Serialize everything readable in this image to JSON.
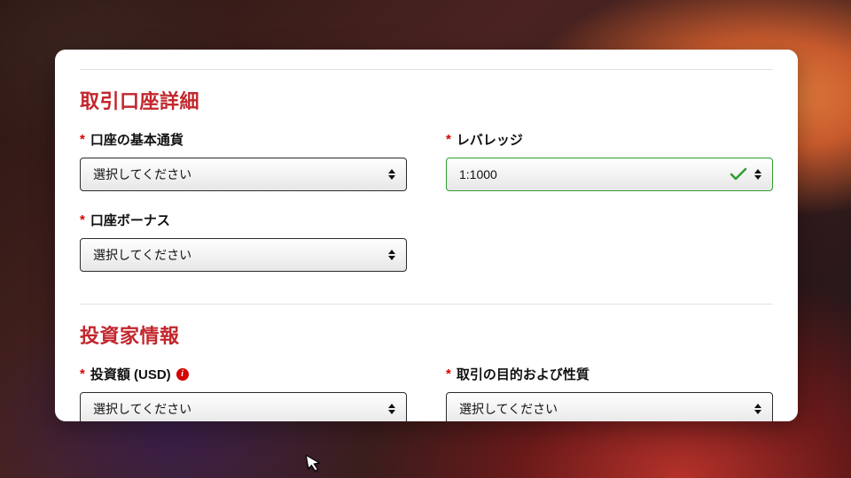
{
  "required_mark": "*",
  "placeholder": "選択してください",
  "section_account": {
    "title": "取引口座詳細",
    "currency_label": "口座の基本通貨",
    "leverage_label": "レバレッジ",
    "leverage_value": "1:1000",
    "bonus_label": "口座ボーナス"
  },
  "section_investor": {
    "title": "投資家情報",
    "amount_label": "投資額 (USD)",
    "purpose_label": "取引の目的および性質"
  }
}
